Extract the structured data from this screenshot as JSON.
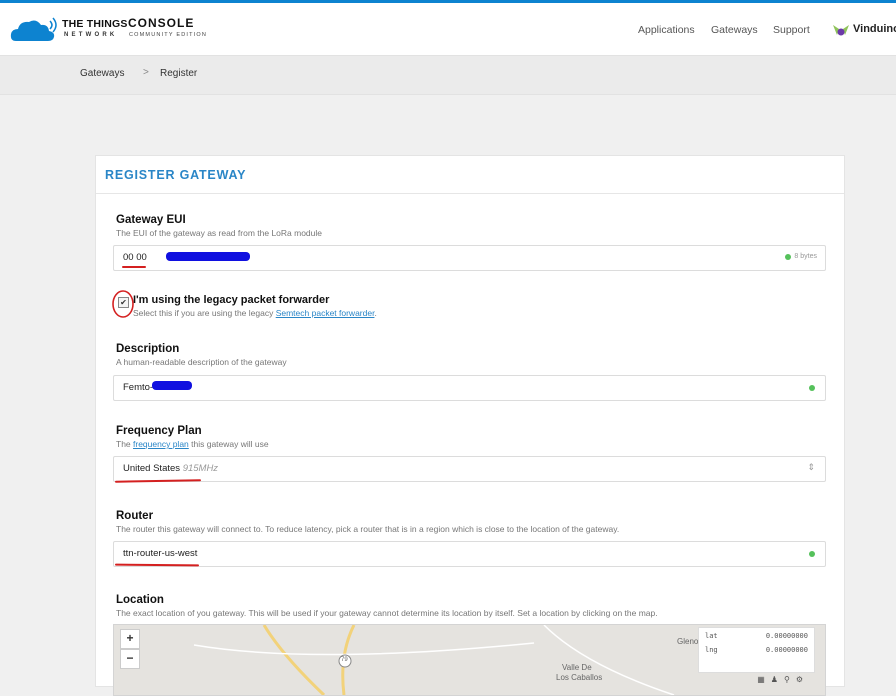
{
  "header": {
    "brand_line1": "THE THINGS",
    "brand_line2": "NETWORK",
    "console": "CONSOLE",
    "edition": "COMMUNITY EDITION",
    "nav": [
      "Applications",
      "Gateways",
      "Support"
    ],
    "user": "Vinduino"
  },
  "breadcrumb": {
    "items": [
      "Gateways",
      "Register"
    ],
    "separator": ">"
  },
  "card": {
    "title": "REGISTER GATEWAY"
  },
  "form": {
    "eui": {
      "label": "Gateway EUI",
      "help": "The EUI of the gateway as read from the LoRa module",
      "value": "00 00",
      "bytes": "8 bytes"
    },
    "legacy": {
      "label": "I'm using the legacy packet forwarder",
      "help_prefix": "Select this if you are using the legacy ",
      "help_link": "Semtech packet forwarder",
      "help_suffix": ".",
      "checked": true
    },
    "description": {
      "label": "Description",
      "help": "A human-readable description of the gateway",
      "value": "Femto-"
    },
    "frequency": {
      "label": "Frequency Plan",
      "help_prefix": "The ",
      "help_link": "frequency plan",
      "help_suffix": " this gateway will use",
      "value": "United States",
      "value_suffix": "915MHz"
    },
    "router": {
      "label": "Router",
      "help": "The router this gateway will connect to. To reduce latency, pick a router that is in a region which is close to the location of the gateway.",
      "value": "ttn-router-us-west"
    },
    "location": {
      "label": "Location",
      "help": "The exact location of you gateway. This will be used if your gateway cannot determine its location by itself. Set a location by clicking on the map.",
      "zoom_in": "+",
      "zoom_out": "−",
      "lat_label": "lat",
      "lat_value": "0.00000000",
      "lng_label": "lng",
      "lng_value": "0.00000000",
      "map_labels": [
        "Gleno",
        "Valle De",
        "Los Caballos"
      ],
      "road_badge": "79"
    }
  },
  "colors": {
    "accent": "#2a86c7",
    "status_ok": "#55c15b",
    "annotation": "#d42020"
  }
}
